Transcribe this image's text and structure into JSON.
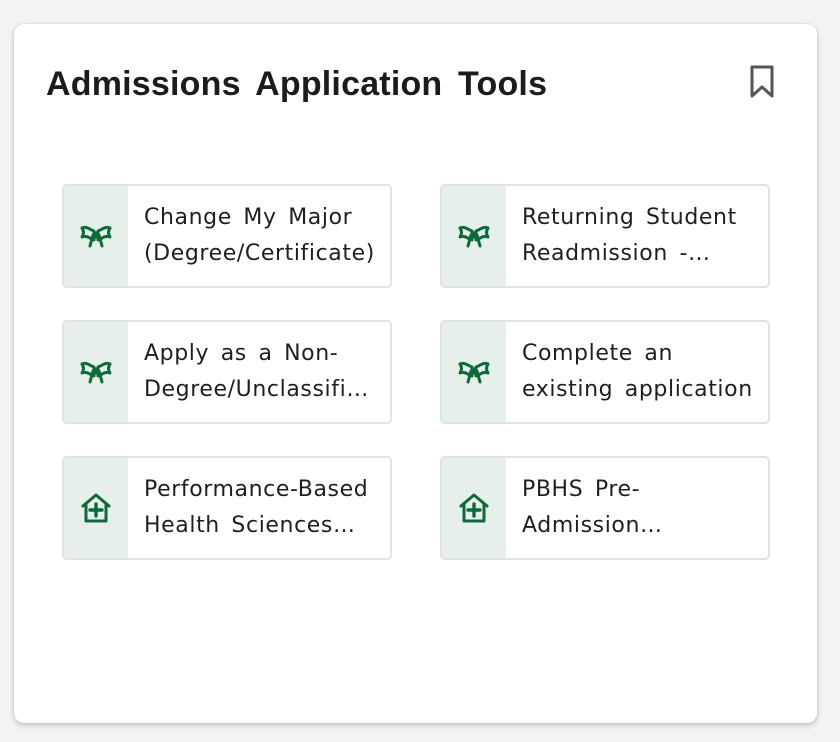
{
  "widget": {
    "title": "Admissions Application Tools",
    "bookmark_icon": "bookmark-icon",
    "accent_color": "#0b6b3a",
    "icon_bg_color": "#e6efea"
  },
  "tools": [
    {
      "label": "Change My Major (Degree/Certificate)",
      "icon": "diploma-icon"
    },
    {
      "label": "Returning Student Readmission - Application",
      "icon": "diploma-icon"
    },
    {
      "label": "Apply as a Non-Degree/Unclassified Student",
      "icon": "diploma-icon"
    },
    {
      "label": "Complete an existing application",
      "icon": "diploma-icon"
    },
    {
      "label": "Performance-Based Health Sciences Admission",
      "icon": "health-house-icon"
    },
    {
      "label": "PBHS Pre-Admission Application",
      "icon": "health-house-icon"
    }
  ]
}
